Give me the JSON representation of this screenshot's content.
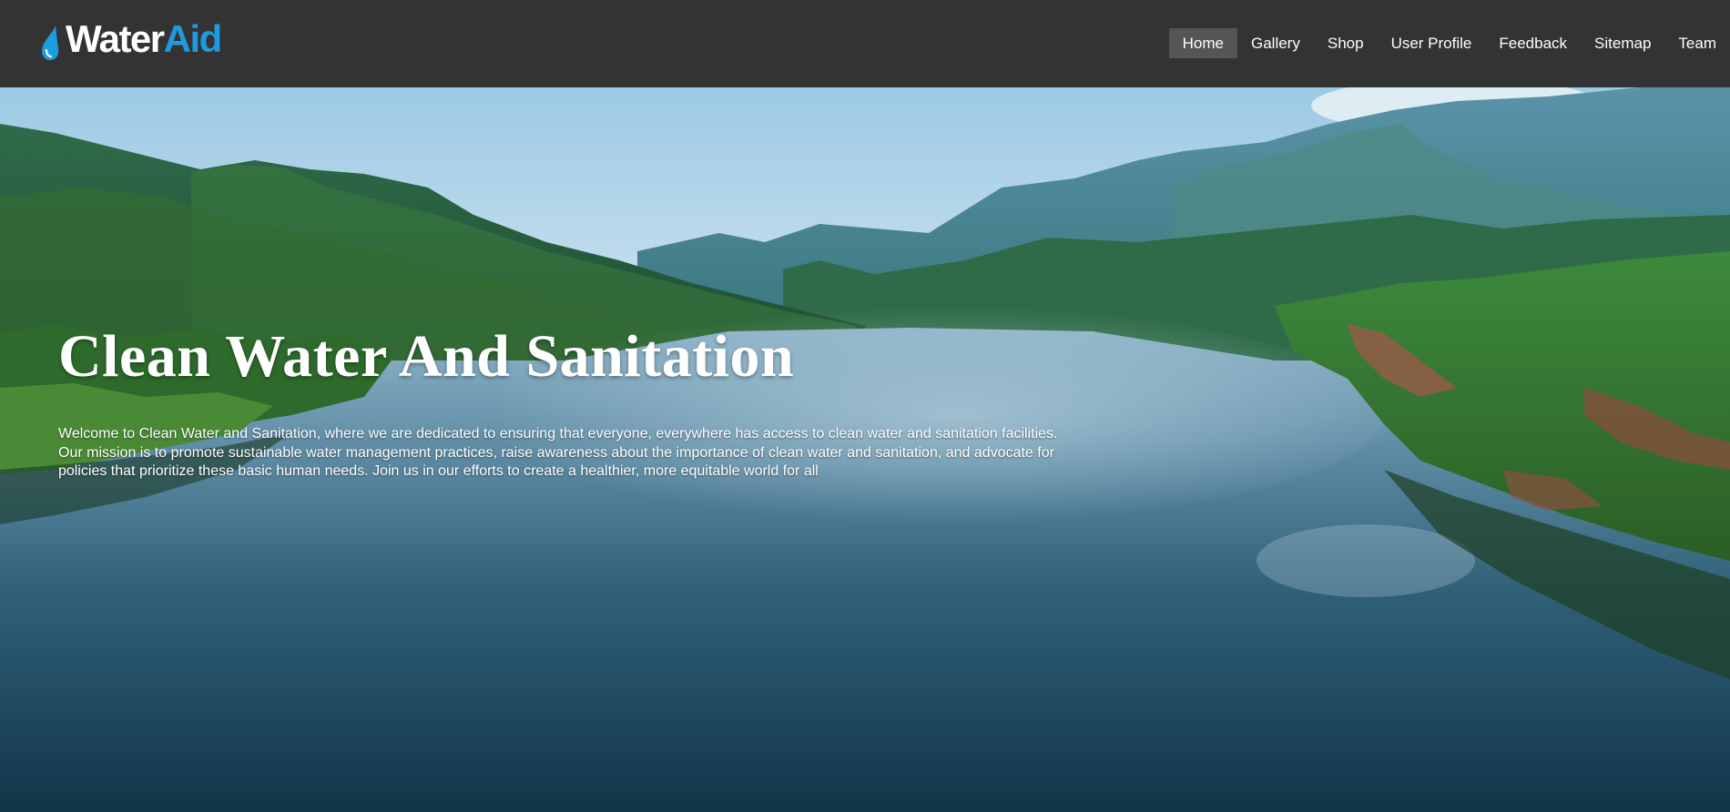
{
  "header": {
    "logo": {
      "word_primary": "Water",
      "word_accent": "Aid",
      "icon": "water-drop-icon",
      "accent_color": "#1e9be0"
    },
    "nav": {
      "items": [
        {
          "label": "Home",
          "active": true
        },
        {
          "label": "Gallery",
          "active": false
        },
        {
          "label": "Shop",
          "active": false
        },
        {
          "label": "User Profile",
          "active": false
        },
        {
          "label": "Feedback",
          "active": false
        },
        {
          "label": "Sitemap",
          "active": false
        },
        {
          "label": "Team",
          "active": false
        }
      ]
    }
  },
  "hero": {
    "title": "Clean Water And Sanitation",
    "description": "Welcome to Clean Water and Sanitation, where we are dedicated to ensuring that everyone, everywhere has access to clean water and sanitation facilities. Our mission is to promote sustainable water management practices, raise awareness about the importance of clean water and sanitation, and advocate for policies that prioritize these basic human needs. Join us in our efforts to create a healthier, more equitable world for all",
    "background": "lake-with-mountains-image"
  },
  "colors": {
    "header_bg": "#333333",
    "nav_active_bg": "#555555",
    "text": "#ffffff"
  }
}
